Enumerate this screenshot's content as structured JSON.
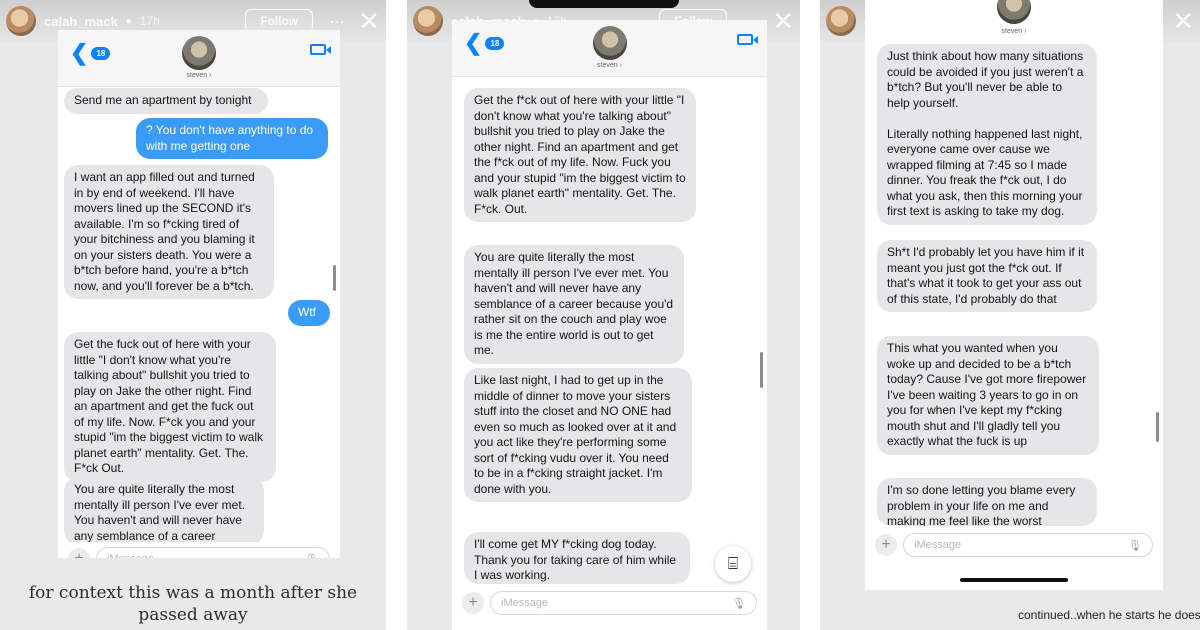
{
  "colors": {
    "incoming": "#e6e6e9",
    "outgoing": "#3a9cf7",
    "accent": "#0a84ff"
  },
  "icons": {
    "back": "chevron-left-icon",
    "video": "video-camera-icon",
    "plus": "plus-icon",
    "mic": "microphone-icon",
    "scan": "live-text-icon",
    "more": "more-dots-icon",
    "close": "close-icon"
  },
  "story": {
    "username": "calah_mack",
    "verified": "●",
    "time": "17h",
    "follow": "Follow",
    "more": "···",
    "close": "✕"
  },
  "header": {
    "back_arrow": "❮",
    "unread_badge": "18",
    "contact": "steven ›"
  },
  "composer": {
    "plus": "+",
    "placeholder": "iMessage",
    "mic": "🎙"
  },
  "panel1": {
    "messages": [
      {
        "dir": "in",
        "text": "Send me an apartment by tonight"
      },
      {
        "dir": "out",
        "text": "? You don't have anything to do with me getting one"
      },
      {
        "dir": "in",
        "text": "I want an app filled out and turned in by end of weekend. I'll have movers lined up the SECOND it's available. I'm so f*cking tired of your bitchiness and you blaming it on your sisters death. You were a b*tch before hand, you're a b*tch now, and you'll forever be a b*tch."
      },
      {
        "dir": "out",
        "text": "Wtf"
      },
      {
        "dir": "in",
        "text": "Get the fuck out of here with your little \"I don't know what you're talking about\" bullshit you tried to play on Jake the other night. Find an apartment and get the fuck out of my life. Now. F*ck you and your stupid \"im the biggest victim to walk planet earth\" mentality. Get. The. F*ck Out."
      },
      {
        "dir": "in",
        "text": "You are quite literally the most mentally ill person I've ever met. You haven't and will never have any semblance of a career because you'd rather sit on the"
      }
    ],
    "caption": "for context this was a month after she passed away"
  },
  "panel2": {
    "messages": [
      {
        "dir": "in",
        "text": "Get the f*ck out of here with your little \"I don't know what you're talking about\" bullshit you tried to play on Jake the other night. Find an apartment and get the f*ck out of my life. Now. Fuck you and your stupid \"im the biggest victim to walk planet earth\" mentality. Get. The. F*ck. Out."
      },
      {
        "dir": "in",
        "text": "You are quite literally the most mentally ill person I've ever met. You haven't and will never have any semblance of a career because you'd rather sit on the couch and play woe is me the entire world is out to get me."
      },
      {
        "dir": "in",
        "text": "Like last night, I had to get up in the middle of dinner to move your sisters stuff into the closet and NO ONE had even so much as looked over at it and you act like they're performing some sort of f*cking vudu over it. You need to be in a f*cking straight jacket. I'm done with you."
      },
      {
        "dir": "in",
        "text": "I'll come get MY f*cking dog today. Thank you for taking care of him while I was working."
      }
    ],
    "scan": "⌸"
  },
  "panel3": {
    "messages": [
      {
        "dir": "in",
        "text": "Just think about how many situations could be avoided if you just weren't a b*tch? But you'll never be able to help yourself.\n\nLiterally nothing happened last night, everyone came over cause we wrapped filming at 7:45 so I made dinner. You freak the f*ck out, I do what you ask, then this morning your first text is asking to take my dog."
      },
      {
        "dir": "in",
        "text": "Sh*t I'd probably let you have him if it meant you just got the f*ck out. If that's what it took to get your ass out of this state, I'd probably do that"
      },
      {
        "dir": "in",
        "text": "This what you wanted when you woke up and decided to be a b*tch today? Cause I've got more firepower I've been waiting 3 years to go in on you for when I've kept my f*cking mouth shut and I'll gladly tell you exactly what the fuck is up"
      },
      {
        "dir": "in",
        "text": "I'm so done letting you blame every problem in your life on me and making me feel like the worst"
      }
    ],
    "continued": "continued..when he starts he doesn't stop"
  }
}
